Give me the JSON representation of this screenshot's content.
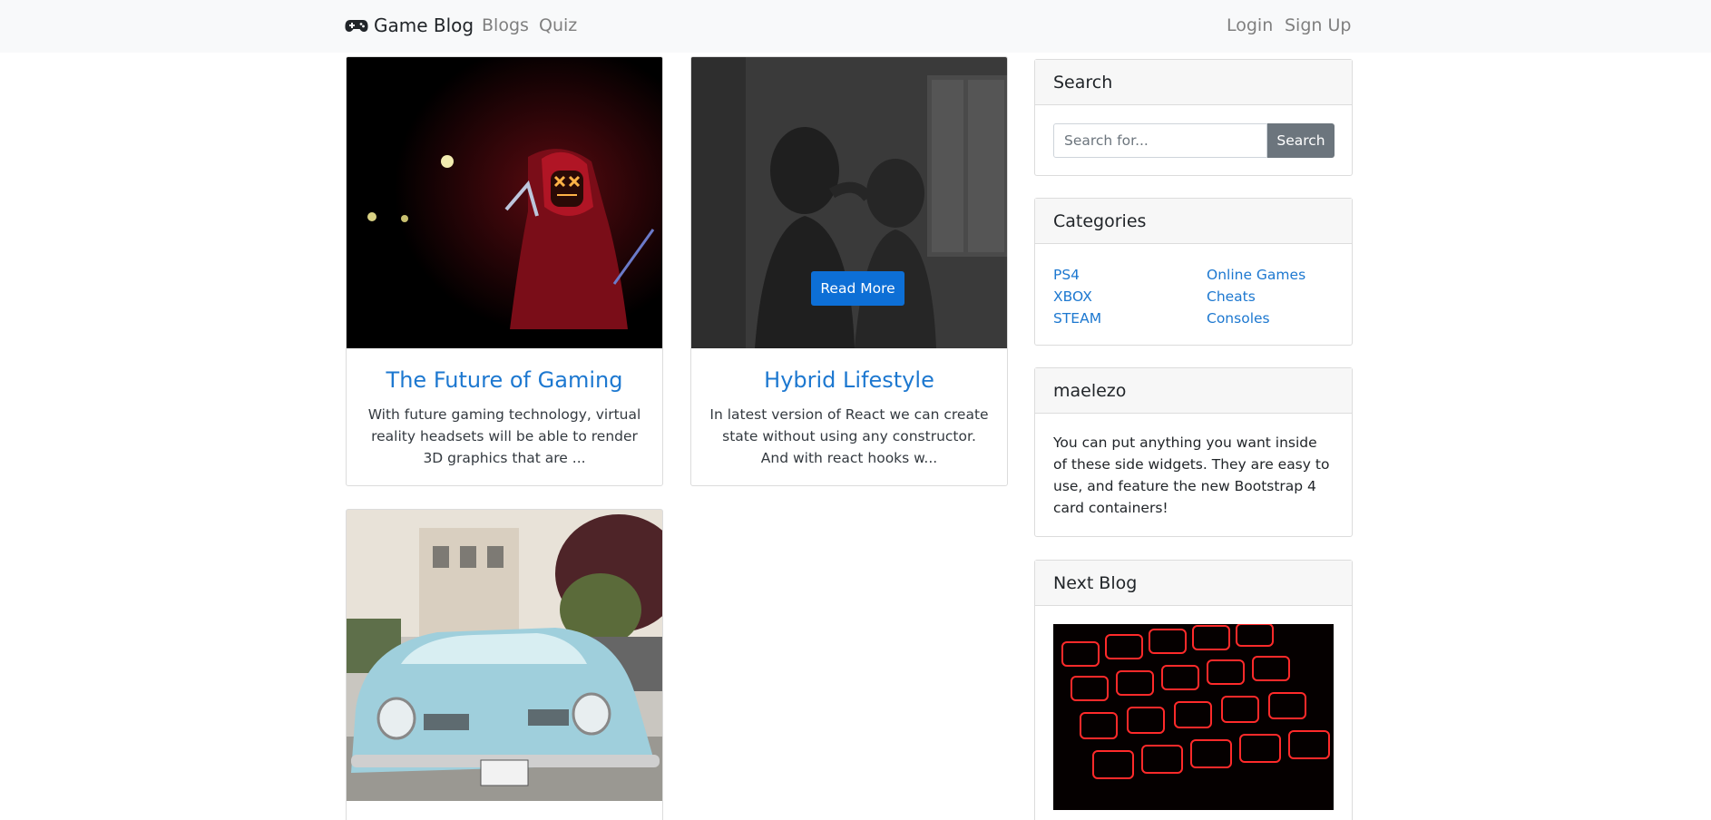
{
  "navbar": {
    "brand": "Game Blog",
    "links": [
      "Blogs",
      "Quiz"
    ],
    "right_links": [
      "Login",
      "Sign Up"
    ]
  },
  "posts": [
    {
      "title": "The Future of Gaming",
      "excerpt": "With future gaming technology, virtual reality headsets will be able to render 3D graphics that are ...",
      "image": "red-mask-hoodie-photo"
    },
    {
      "title": "Hybrid Lifestyle",
      "excerpt": "In latest version of React we can create state without using any constructor. And with react hooks w...",
      "image": "silhouette-children-photo",
      "button_label": "Read More"
    },
    {
      "image": "blue-vintage-car-photo"
    }
  ],
  "sidebar": {
    "search": {
      "title": "Search",
      "placeholder": "Search for...",
      "button_label": "Search"
    },
    "categories": {
      "title": "Categories",
      "left": [
        "PS4",
        "XBOX",
        "STEAM"
      ],
      "right": [
        "Online Games",
        "Cheats",
        "Consoles"
      ]
    },
    "widget": {
      "title": "maelezo",
      "text": "You can put anything you want inside of these side widgets. They are easy to use, and feature the new Bootstrap 4 card containers!"
    },
    "next_blog": {
      "title": "Next Blog",
      "image": "red-backlit-keyboard-photo"
    }
  },
  "colors": {
    "link_blue": "#1d78d0",
    "primary_button": "#0d6fd6",
    "secondary_button": "#6c757d",
    "navbar_bg": "#f8f9fa"
  }
}
